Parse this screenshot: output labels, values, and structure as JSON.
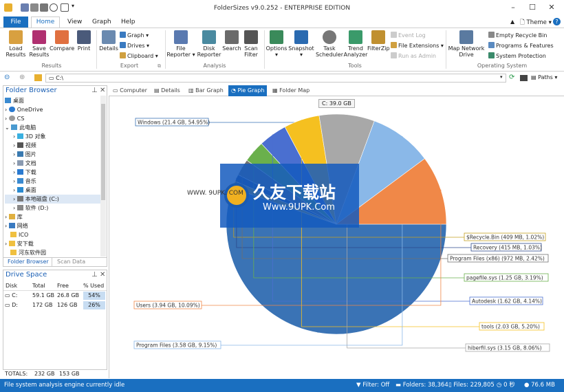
{
  "window": {
    "title": "FolderSizes v9.0.252 - ENTERPRISE EDITION"
  },
  "menu": {
    "file": "File",
    "tabs": [
      "Home",
      "View",
      "Graph",
      "Help"
    ],
    "theme": "Theme"
  },
  "ribbon": {
    "results": {
      "load": "Load Results",
      "save": "Save Results",
      "compare": "Compare",
      "print": "Print",
      "label": "Results"
    },
    "export": {
      "details": "Details",
      "graph": "Graph",
      "drives": "Drives",
      "clipboard": "Clipboard",
      "label": "Export"
    },
    "analysis": {
      "file_reporter": "File Reporter",
      "disk_reporter": "Disk Reporter",
      "search": "Search",
      "scan_filter": "Scan Filter",
      "label": "Analysis"
    },
    "tools": {
      "options": "Options",
      "snapshot": "Snapshot",
      "task_scheduler": "Task Scheduler",
      "trend_analyzer": "Trend Analyzer",
      "filezip": "FilterZip",
      "event_log": "Event Log",
      "file_extensions": "File Extensions",
      "run_as_admin": "Run as Admin",
      "label": "Tools"
    },
    "os": {
      "map_network_drive": "Map Network Drive",
      "empty_recycle_bin": "Empty Recycle Bin",
      "programs_features": "Programs & Features",
      "system_protection": "System Protection",
      "label": "Operating System"
    }
  },
  "address": {
    "path": "C:\\",
    "paths_label": "Paths"
  },
  "folder_browser": {
    "title": "Folder Browser",
    "items": [
      "桌面",
      "OneDrive",
      "CS",
      "此电脑",
      "3D 对象",
      "视频",
      "图片",
      "文档",
      "下载",
      "音乐",
      "桌面",
      "本地磁盘 (C:)",
      "软件 (D:)",
      "库",
      "网络",
      "ICO",
      "安下载",
      "河东软件园"
    ],
    "tabs": [
      "Folder Browser",
      "Scan Data"
    ]
  },
  "drive_space": {
    "title": "Drive Space",
    "headers": [
      "Disk",
      "Total",
      "Free",
      "% Used"
    ],
    "rows": [
      {
        "disk": "C:",
        "total": "59.1 GB",
        "free": "26.8 GB",
        "used": "54%"
      },
      {
        "disk": "D:",
        "total": "172 GB",
        "free": "126 GB",
        "used": "26%"
      }
    ],
    "totals_label": "TOTALS:",
    "totals_total": "232 GB",
    "totals_free": "153 GB"
  },
  "view_tabs": [
    "Computer",
    "Details",
    "Bar Graph",
    "Pie Graph",
    "Folder Map"
  ],
  "chart_data": {
    "type": "pie",
    "title": "C:  39.0 GB",
    "slices": [
      {
        "label": "Windows (21.4 GB, 54.95%)",
        "value": 54.95,
        "color": "#3a73b5"
      },
      {
        "label": "$Recycle.Bin (409 MB, 1.02%)",
        "value": 1.02,
        "color": "#c4a020"
      },
      {
        "label": "Recovery (415 MB, 1.03%)",
        "value": 1.03,
        "color": "#2d4a8c"
      },
      {
        "label": "Program Files (x86) (972 MB, 2.42%)",
        "value": 2.42,
        "color": "#707070"
      },
      {
        "label": "pagefile.sys (1.25 GB, 3.19%)",
        "value": 3.19,
        "color": "#6ab04c"
      },
      {
        "label": "Autodesk (1.62 GB, 4.14%)",
        "value": 4.14,
        "color": "#4a6fd0"
      },
      {
        "label": "tools (2.03 GB, 5.20%)",
        "value": 5.2,
        "color": "#f5c020"
      },
      {
        "label": "hiberfil.sys (3.15 GB, 8.06%)",
        "value": 8.06,
        "color": "#a8a8a8"
      },
      {
        "label": "Program Files (3.58 GB, 9.15%)",
        "value": 9.15,
        "color": "#8ab8e8"
      },
      {
        "label": "Users (3.94 GB, 10.09%)",
        "value": 10.09,
        "color": "#f08848"
      }
    ]
  },
  "watermark": {
    "line1": "久友下载站",
    "line2": "Www.9UPK.Com",
    "left": "WWW. 9UPK. COM"
  },
  "status": {
    "text": "File system analysis engine currently idle",
    "filter": "Filter: Off",
    "folders": "Folders: 38,364",
    "files": "Files: 229,805",
    "time": "0 秒",
    "size": "76.6 MB"
  }
}
